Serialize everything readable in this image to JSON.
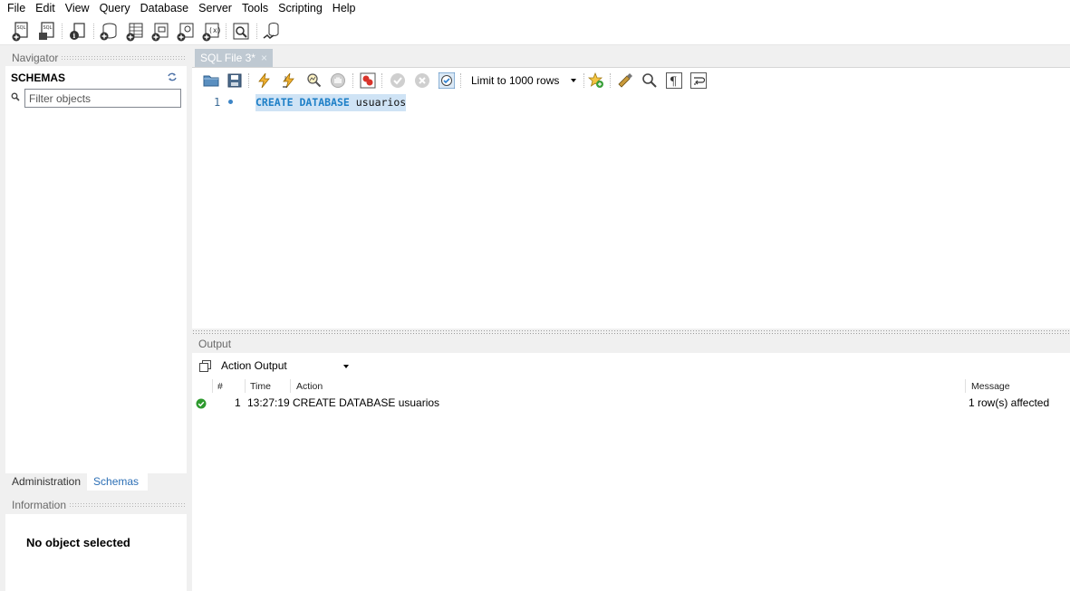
{
  "menu": [
    "File",
    "Edit",
    "View",
    "Query",
    "Database",
    "Server",
    "Tools",
    "Scripting",
    "Help"
  ],
  "navigator": {
    "header": "Navigator",
    "schemas_title": "SCHEMAS",
    "filter_placeholder": "Filter objects",
    "tabs": [
      "Administration",
      "Schemas"
    ]
  },
  "information": {
    "header": "Information",
    "message": "No object selected"
  },
  "editor": {
    "tab_label": "SQL File 3*",
    "tab_close": "×",
    "limit_label": "Limit to 1000 rows",
    "line_number": "1",
    "code_keyword": "CREATE DATABASE",
    "code_ident": "usuarios"
  },
  "output": {
    "header": "Output",
    "select_label": "Action Output",
    "columns": [
      "#",
      "Time",
      "Action",
      "Message"
    ],
    "rows": [
      {
        "num": "1",
        "time": "13:27:19",
        "action": "CREATE DATABASE usuarios",
        "message": "1 row(s) affected",
        "status": "success"
      }
    ]
  },
  "colors": {
    "accent": "#2c6fb5",
    "keyword": "#1d7fc7",
    "selection": "#cfe3f5",
    "success": "#2e9a2e"
  }
}
